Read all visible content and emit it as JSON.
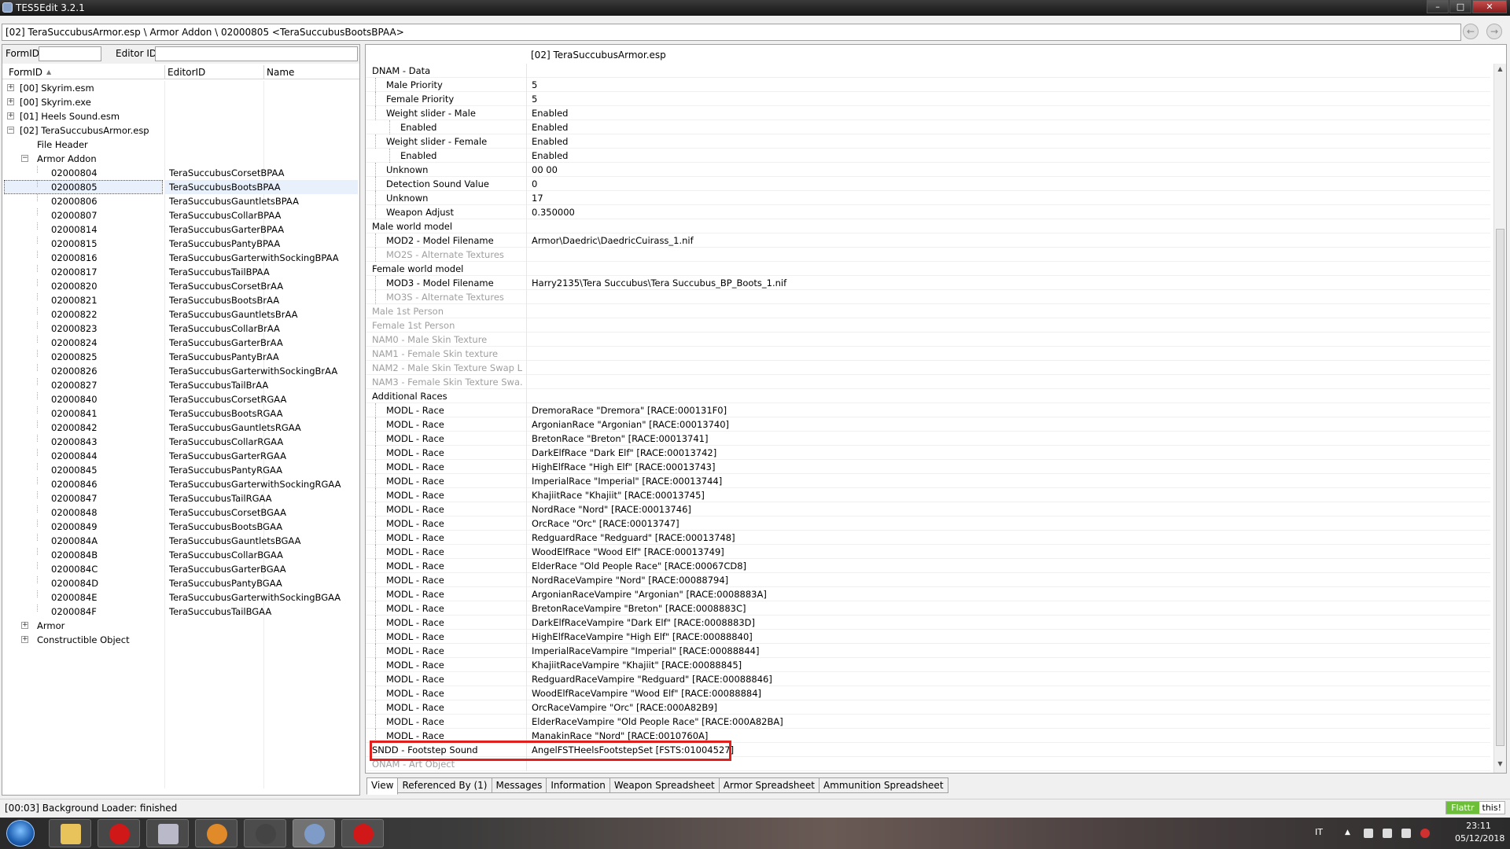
{
  "window": {
    "title": "TES5Edit 3.2.1",
    "minimize": "–",
    "maximize": "□",
    "close": "✕"
  },
  "path": "[02] TeraSuccubusArmor.esp \\ Armor Addon \\ 02000805 <TeraSuccubusBootsBPAA>",
  "filter": {
    "formid_label": "FormID",
    "editorid_label": "Editor ID"
  },
  "tree_headers": {
    "formid": "FormID",
    "editorid": "EditorID",
    "name": "Name"
  },
  "tree": {
    "files": [
      {
        "label": "[00] Skyrim.esm",
        "expander": "+"
      },
      {
        "label": "[00] Skyrim.exe",
        "expander": "+"
      },
      {
        "label": "[01] Heels Sound.esm",
        "expander": "+"
      },
      {
        "label": "[02] TeraSuccubusArmor.esp",
        "expander": "−"
      }
    ],
    "file_header": "File Header",
    "armor_addon": {
      "label": "Armor Addon",
      "expander": "−"
    },
    "records": [
      {
        "formid": "02000804",
        "edid": "TeraSuccubusCorsetBPAA"
      },
      {
        "formid": "02000805",
        "edid": "TeraSuccubusBootsBPAA"
      },
      {
        "formid": "02000806",
        "edid": "TeraSuccubusGauntletsBPAA"
      },
      {
        "formid": "02000807",
        "edid": "TeraSuccubusCollarBPAA"
      },
      {
        "formid": "02000814",
        "edid": "TeraSuccubusGarterBPAA"
      },
      {
        "formid": "02000815",
        "edid": "TeraSuccubusPantyBPAA"
      },
      {
        "formid": "02000816",
        "edid": "TeraSuccubusGarterwithSockingBPAA"
      },
      {
        "formid": "02000817",
        "edid": "TeraSuccubusTailBPAA"
      },
      {
        "formid": "02000820",
        "edid": "TeraSuccubusCorsetBrAA"
      },
      {
        "formid": "02000821",
        "edid": "TeraSuccubusBootsBrAA"
      },
      {
        "formid": "02000822",
        "edid": "TeraSuccubusGauntletsBrAA"
      },
      {
        "formid": "02000823",
        "edid": "TeraSuccubusCollarBrAA"
      },
      {
        "formid": "02000824",
        "edid": "TeraSuccubusGarterBrAA"
      },
      {
        "formid": "02000825",
        "edid": "TeraSuccubusPantyBrAA"
      },
      {
        "formid": "02000826",
        "edid": "TeraSuccubusGarterwithSockingBrAA"
      },
      {
        "formid": "02000827",
        "edid": "TeraSuccubusTailBrAA"
      },
      {
        "formid": "02000840",
        "edid": "TeraSuccubusCorsetRGAA"
      },
      {
        "formid": "02000841",
        "edid": "TeraSuccubusBootsRGAA"
      },
      {
        "formid": "02000842",
        "edid": "TeraSuccubusGauntletsRGAA"
      },
      {
        "formid": "02000843",
        "edid": "TeraSuccubusCollarRGAA"
      },
      {
        "formid": "02000844",
        "edid": "TeraSuccubusGarterRGAA"
      },
      {
        "formid": "02000845",
        "edid": "TeraSuccubusPantyRGAA"
      },
      {
        "formid": "02000846",
        "edid": "TeraSuccubusGarterwithSockingRGAA"
      },
      {
        "formid": "02000847",
        "edid": "TeraSuccubusTailRGAA"
      },
      {
        "formid": "02000848",
        "edid": "TeraSuccubusCorsetBGAA"
      },
      {
        "formid": "02000849",
        "edid": "TeraSuccubusBootsBGAA"
      },
      {
        "formid": "0200084A",
        "edid": "TeraSuccubusGauntletsBGAA"
      },
      {
        "formid": "0200084B",
        "edid": "TeraSuccubusCollarBGAA"
      },
      {
        "formid": "0200084C",
        "edid": "TeraSuccubusGarterBGAA"
      },
      {
        "formid": "0200084D",
        "edid": "TeraSuccubusPantyBGAA"
      },
      {
        "formid": "0200084E",
        "edid": "TeraSuccubusGarterwithSockingBGAA"
      },
      {
        "formid": "0200084F",
        "edid": "TeraSuccubusTailBGAA"
      }
    ],
    "groups_after": [
      {
        "label": "Armor",
        "expander": "+"
      },
      {
        "label": "Constructible Object",
        "expander": "+"
      }
    ]
  },
  "view": {
    "column_header": "[02] TeraSuccubusArmor.esp",
    "rows": [
      {
        "k": "DNAM - Data",
        "v": "",
        "indent": 0
      },
      {
        "k": "Male Priority",
        "v": "5",
        "indent": 1
      },
      {
        "k": "Female Priority",
        "v": "5",
        "indent": 1
      },
      {
        "k": "Weight slider - Male",
        "v": "Enabled",
        "indent": 1
      },
      {
        "k": "Enabled",
        "v": "Enabled",
        "indent": 2
      },
      {
        "k": "Weight slider - Female",
        "v": "Enabled",
        "indent": 1
      },
      {
        "k": "Enabled",
        "v": "Enabled",
        "indent": 2
      },
      {
        "k": "Unknown",
        "v": "00 00",
        "indent": 1
      },
      {
        "k": "Detection Sound Value",
        "v": "0",
        "indent": 1
      },
      {
        "k": "Unknown",
        "v": "17",
        "indent": 1
      },
      {
        "k": "Weapon Adjust",
        "v": "0.350000",
        "indent": 1
      },
      {
        "k": "Male world model",
        "v": "",
        "indent": 0
      },
      {
        "k": "MOD2 - Model Filename",
        "v": "Armor\\Daedric\\DaedricCuirass_1.nif",
        "indent": 1
      },
      {
        "k": "MO2S - Alternate Textures",
        "v": "",
        "indent": 1,
        "gray": true
      },
      {
        "k": "Female world model",
        "v": "",
        "indent": 0
      },
      {
        "k": "MOD3 - Model Filename",
        "v": "Harry2135\\Tera Succubus\\Tera Succubus_BP_Boots_1.nif",
        "indent": 1
      },
      {
        "k": "MO3S - Alternate Textures",
        "v": "",
        "indent": 1,
        "gray": true
      },
      {
        "k": "Male 1st Person",
        "v": "",
        "indent": 0,
        "gray": true
      },
      {
        "k": "Female 1st Person",
        "v": "",
        "indent": 0,
        "gray": true
      },
      {
        "k": "NAM0 - Male Skin Texture",
        "v": "",
        "indent": 0,
        "gray": true
      },
      {
        "k": "NAM1 - Female Skin texture",
        "v": "",
        "indent": 0,
        "gray": true
      },
      {
        "k": "NAM2 - Male Skin Texture Swap L...",
        "v": "",
        "indent": 0,
        "gray": true
      },
      {
        "k": "NAM3 - Female Skin Texture Swa...",
        "v": "",
        "indent": 0,
        "gray": true
      },
      {
        "k": "Additional Races",
        "v": "",
        "indent": 0
      },
      {
        "k": "MODL - Race",
        "v": "DremoraRace \"Dremora\" [RACE:000131F0]",
        "indent": 1
      },
      {
        "k": "MODL - Race",
        "v": "ArgonianRace \"Argonian\" [RACE:00013740]",
        "indent": 1
      },
      {
        "k": "MODL - Race",
        "v": "BretonRace \"Breton\" [RACE:00013741]",
        "indent": 1
      },
      {
        "k": "MODL - Race",
        "v": "DarkElfRace \"Dark Elf\" [RACE:00013742]",
        "indent": 1
      },
      {
        "k": "MODL - Race",
        "v": "HighElfRace \"High Elf\" [RACE:00013743]",
        "indent": 1
      },
      {
        "k": "MODL - Race",
        "v": "ImperialRace \"Imperial\" [RACE:00013744]",
        "indent": 1
      },
      {
        "k": "MODL - Race",
        "v": "KhajiitRace \"Khajiit\" [RACE:00013745]",
        "indent": 1
      },
      {
        "k": "MODL - Race",
        "v": "NordRace \"Nord\" [RACE:00013746]",
        "indent": 1
      },
      {
        "k": "MODL - Race",
        "v": "OrcRace \"Orc\" [RACE:00013747]",
        "indent": 1
      },
      {
        "k": "MODL - Race",
        "v": "RedguardRace \"Redguard\" [RACE:00013748]",
        "indent": 1
      },
      {
        "k": "MODL - Race",
        "v": "WoodElfRace \"Wood Elf\" [RACE:00013749]",
        "indent": 1
      },
      {
        "k": "MODL - Race",
        "v": "ElderRace \"Old People Race\" [RACE:00067CD8]",
        "indent": 1
      },
      {
        "k": "MODL - Race",
        "v": "NordRaceVampire \"Nord\" [RACE:00088794]",
        "indent": 1
      },
      {
        "k": "MODL - Race",
        "v": "ArgonianRaceVampire \"Argonian\" [RACE:0008883A]",
        "indent": 1
      },
      {
        "k": "MODL - Race",
        "v": "BretonRaceVampire \"Breton\" [RACE:0008883C]",
        "indent": 1
      },
      {
        "k": "MODL - Race",
        "v": "DarkElfRaceVampire \"Dark Elf\" [RACE:0008883D]",
        "indent": 1
      },
      {
        "k": "MODL - Race",
        "v": "HighElfRaceVampire \"High Elf\" [RACE:00088840]",
        "indent": 1
      },
      {
        "k": "MODL - Race",
        "v": "ImperialRaceVampire \"Imperial\" [RACE:00088844]",
        "indent": 1
      },
      {
        "k": "MODL - Race",
        "v": "KhajiitRaceVampire \"Khajiit\" [RACE:00088845]",
        "indent": 1
      },
      {
        "k": "MODL - Race",
        "v": "RedguardRaceVampire \"Redguard\" [RACE:00088846]",
        "indent": 1
      },
      {
        "k": "MODL - Race",
        "v": "WoodElfRaceVampire \"Wood Elf\" [RACE:00088884]",
        "indent": 1
      },
      {
        "k": "MODL - Race",
        "v": "OrcRaceVampire \"Orc\" [RACE:000A82B9]",
        "indent": 1
      },
      {
        "k": "MODL - Race",
        "v": "ElderRaceVampire \"Old People Race\" [RACE:000A82BA]",
        "indent": 1
      },
      {
        "k": "MODL - Race",
        "v": "ManakinRace \"Nord\" [RACE:0010760A]",
        "indent": 1
      },
      {
        "k": "SNDD - Footstep Sound",
        "v": "AngelFSTHeelsFootstepSet [FSTS:01004527]",
        "indent": 0
      },
      {
        "k": "ONAM - Art Object",
        "v": "",
        "indent": 0,
        "gray": true
      }
    ]
  },
  "tabs": [
    "View",
    "Referenced By (1)",
    "Messages",
    "Information",
    "Weapon Spreadsheet",
    "Armor Spreadsheet",
    "Ammunition Spreadsheet"
  ],
  "status": "[00:03] Background Loader: finished",
  "flattr": {
    "brand": "Flattr",
    "action": "this!"
  },
  "taskbar": {
    "lang": "IT",
    "time": "23:11",
    "date": "05/12/2018"
  },
  "colors": {
    "highlight_border": "#e0201c",
    "selection": "#e8f1fb",
    "flattr_green": "#6dbf3a"
  }
}
